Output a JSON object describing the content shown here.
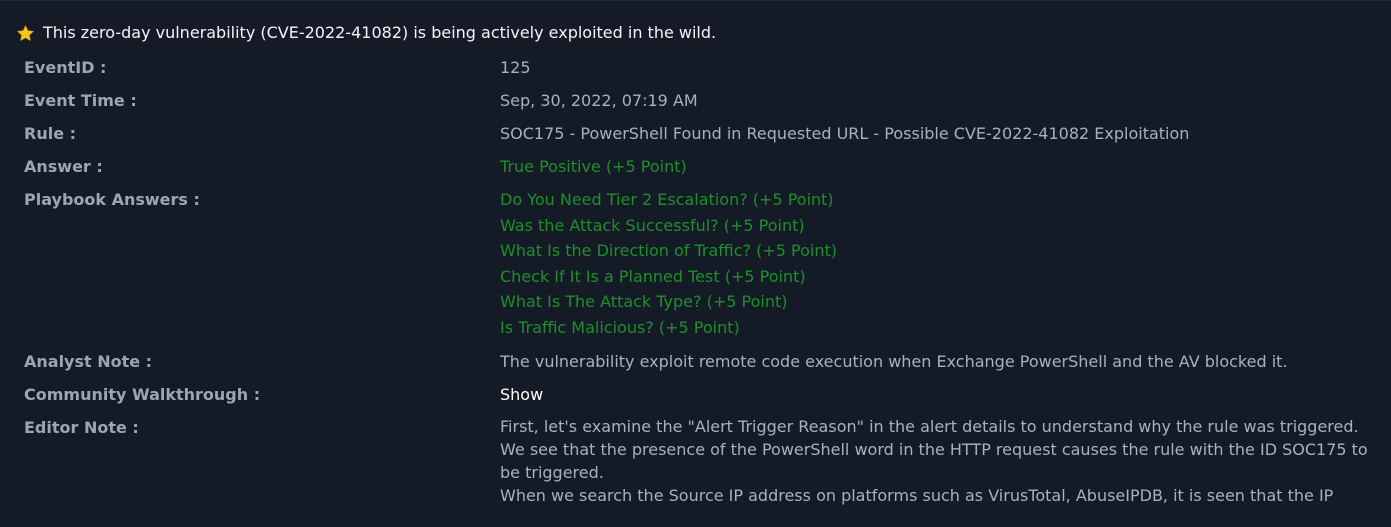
{
  "headline": {
    "icon": "star-icon",
    "icon_color": "#f5c518",
    "text": "This zero-day vulnerability (CVE-2022-41082) is being actively exploited in the wild."
  },
  "fields": {
    "event_id": {
      "label": "EventID :",
      "value": "125"
    },
    "event_time": {
      "label": "Event Time :",
      "value": "Sep, 30, 2022, 07:19 AM"
    },
    "rule": {
      "label": "Rule :",
      "value": "SOC175 - PowerShell Found in Requested URL - Possible CVE-2022-41082 Exploitation"
    },
    "answer": {
      "label": "Answer :",
      "value": "True Positive (+5 Point)"
    },
    "playbook": {
      "label": "Playbook Answers :",
      "items": [
        "Do You Need Tier 2 Escalation? (+5 Point)",
        "Was the Attack Successful? (+5 Point)",
        "What Is the Direction of Traffic? (+5 Point)",
        "Check If It Is a Planned Test (+5 Point)",
        "What Is The Attack Type? (+5 Point)",
        "Is Traffic Malicious? (+5 Point)"
      ]
    },
    "analyst_note": {
      "label": "Analyst Note :",
      "value": "The vulnerability exploit remote code execution when Exchange PowerShell and the AV blocked it."
    },
    "walkthrough": {
      "label": "Community Walkthrough :",
      "value": "Show"
    },
    "editor_note": {
      "label": "Editor Note :",
      "paragraphs": [
        "First, let's examine the \"Alert Trigger Reason\" in the alert details to understand why the rule was triggered. We see that the presence of the PowerShell word in the HTTP request causes the rule with the ID SOC175 to be triggered.",
        "When we search the Source IP address on platforms such as VirusTotal, AbuseIPDB, it is seen that the IP"
      ]
    }
  },
  "colors": {
    "background": "#141b27",
    "label": "#9ea4b2",
    "value": "#aab0bc",
    "success": "#1f8f2a",
    "link": "#ffffff"
  }
}
